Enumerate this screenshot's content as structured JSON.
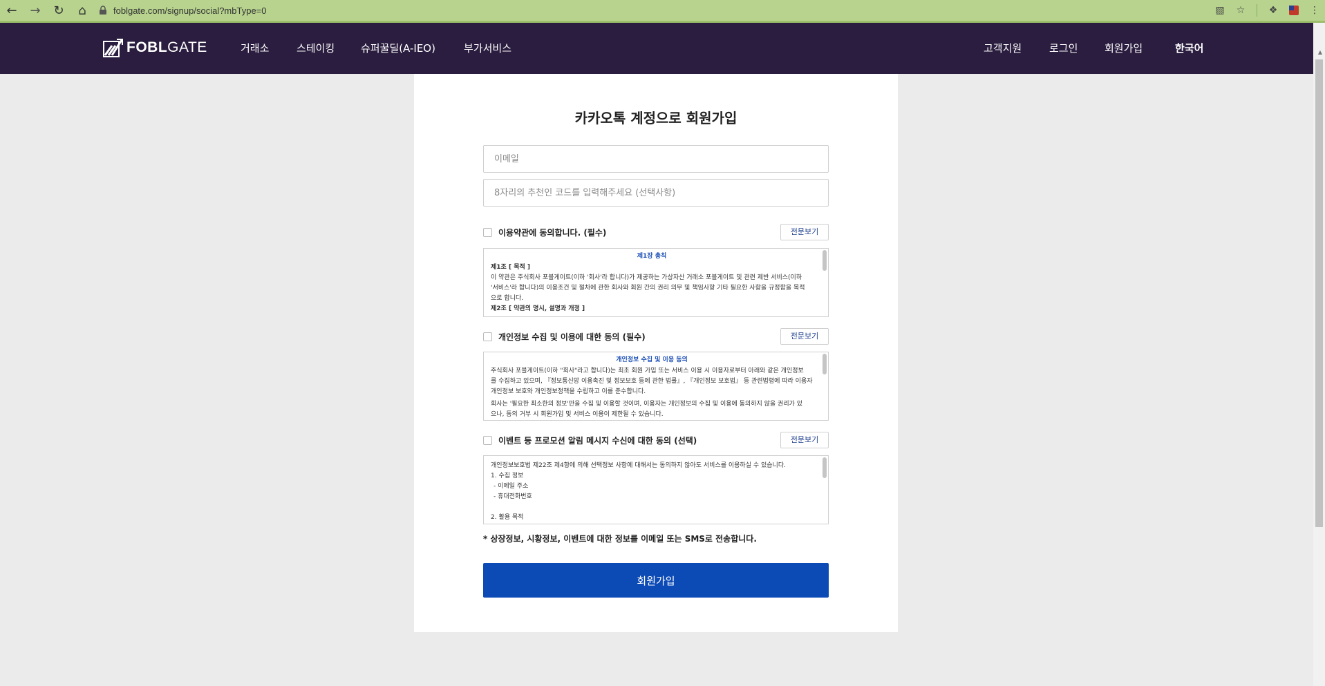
{
  "browser": {
    "url": "foblgate.com/signup/social?mbType=0",
    "icons": [
      "back-icon",
      "forward-icon",
      "reload-icon",
      "home-icon",
      "lock-icon",
      "translate-icon",
      "star-icon",
      "extensions-icon",
      "profile-icon",
      "menu-icon"
    ]
  },
  "header": {
    "logo_bold": "FOBL",
    "logo_light": "GATE",
    "nav": [
      "거래소",
      "스테이킹",
      "슈퍼꿀딜(A-IEO)",
      "부가서비스"
    ],
    "right": [
      "고객지원",
      "로그인",
      "회원가입",
      "한국어"
    ]
  },
  "signup": {
    "title": "카카오톡 계정으로 회원가입",
    "email_placeholder": "이메일",
    "referral_placeholder": "8자리의 추천인 코드를 입력해주세요 (선택사항)",
    "view_label": "전문보기",
    "terms": {
      "label": "이용약관에 동의합니다. (필수)",
      "box_title": "제1장 총칙",
      "lines": [
        "제1조 [ 목적 ]",
        "이 약관은 주식회사 포블게이트(이하 '회사'라 합니다)가 제공하는 가상자산 거래소 포블게이트 및 관련 제반 서비스(이하",
        "'서비스'라 합니다)의 이용조건 및 절차에 관한 회사와 회원 간의 권리 의무 및 책임사항 기타 필요한 사항을 규정함을 목적",
        "으로 합니다.",
        "제2조 [ 약관의 명시, 설명과 개정 ]"
      ]
    },
    "privacy": {
      "label": "개인정보 수집 및 이용에 대한 동의 (필수)",
      "box_title": "개인정보 수집 및 이용 동의",
      "lines": [
        "주식회사 포블게이트(이하 \"회사\"라고 합니다)는 최초 회원 가입 또는 서비스 이용 시 이용자로부터 아래와 같은 개인정보",
        "를 수집하고 있으며, 『정보통신망 이용촉진 및 정보보호 등에 관한 법률』, 『개인정보 보호법』 등 관련법령에 따라 이용자의",
        "개인정보 보호와 개인정보정책을 수립하고 이를 준수합니다.",
        "회사는 '필요한 최소한의 정보'만을 수집 및 이용할 것이며, 이용자는 개인정보의 수집 및 이용에 동의하지 않을 권리가 있",
        "으나, 동의 거부 시 회원가입 및 서비스 이용이 제한될 수 있습니다."
      ]
    },
    "promo": {
      "label": "이벤트 등 프로모션 알림 메시지 수신에 대한 동의 (선택)",
      "lines": [
        "개인정보보호법 제22조 제4항에 의해 선택정보 사항에 대해서는 동의하지 않아도 서비스를 이용하실 수 있습니다.",
        "1. 수집 정보",
        "  - 이메일 주소",
        "  - 휴대전화번호",
        "",
        "2. 활용 목적"
      ]
    },
    "note": "* 상장정보, 시황정보, 이벤트에 대한 정보를 이메일 또는 SMS로 전송합니다.",
    "submit_label": "회원가입"
  }
}
